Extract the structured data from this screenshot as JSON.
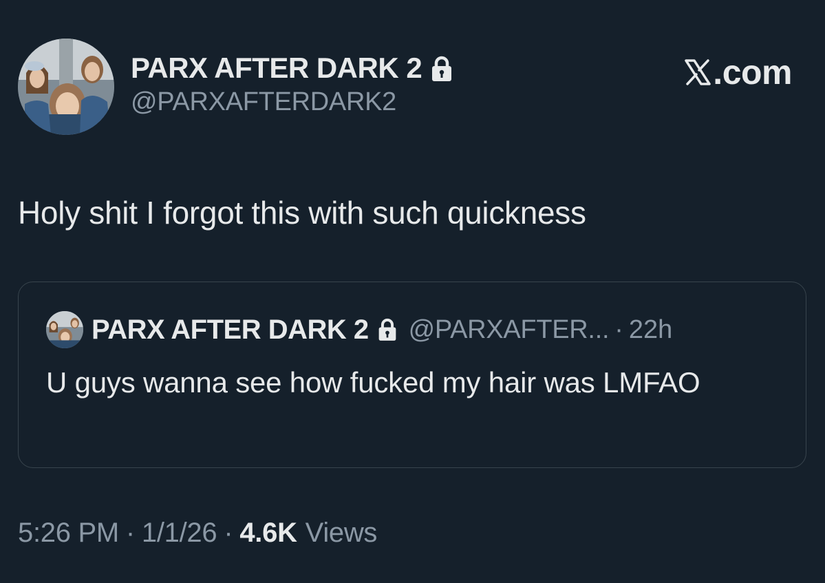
{
  "author": {
    "display_name": "PARX AFTER DARK 2",
    "handle": "@PARXAFTERDARK2",
    "avatar_icon": "avatar-photo",
    "protected_icon": "lock-icon"
  },
  "watermark": {
    "label": ".com",
    "logo_icon": "x-logo-icon"
  },
  "tweet": {
    "text": "Holy shit I forgot this with such quickness"
  },
  "quote": {
    "display_name": "PARX AFTER DARK 2",
    "handle": "@PARXAFTER...",
    "separator": "·",
    "time_ago": "22h",
    "text": "U guys wanna see how fucked my hair was LMFAO"
  },
  "meta": {
    "time": "5:26 PM",
    "separator": "·",
    "date": "1/1/26",
    "views_count": "4.6K",
    "views_label": "Views"
  },
  "colors": {
    "background": "#15202b",
    "primary_text": "#e7e9ea",
    "secondary_text": "#8b98a5",
    "border": "#38444d"
  }
}
